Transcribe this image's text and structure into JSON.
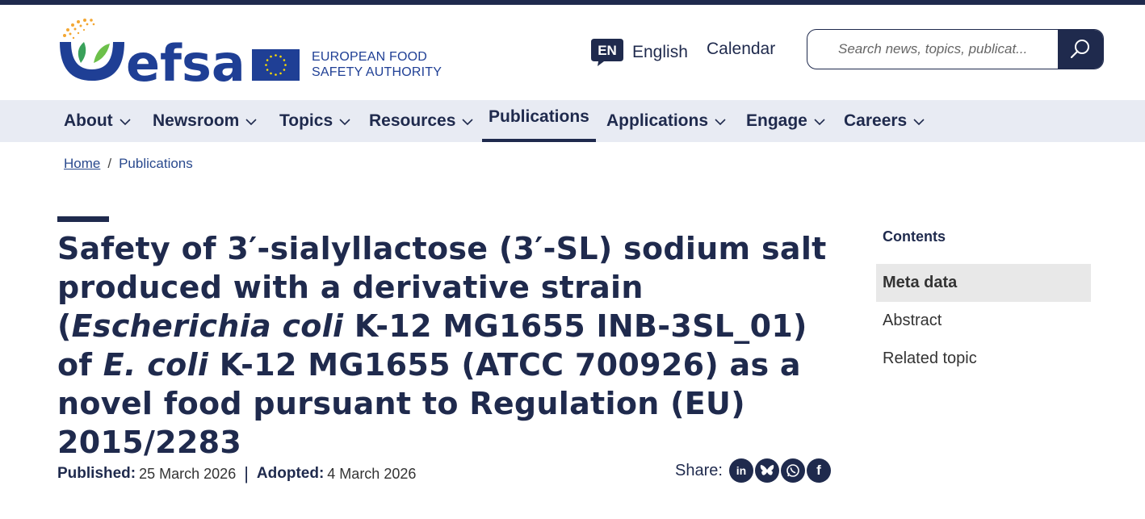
{
  "header": {
    "logo_text": "efsa",
    "authority_line1": "EUROPEAN FOOD",
    "authority_line2": "SAFETY AUTHORITY",
    "lang_badge": "EN",
    "lang_label": "English",
    "calendar_label": "Calendar",
    "search_placeholder": "Search news, topics, publicat..."
  },
  "nav": {
    "items": [
      {
        "label": "About"
      },
      {
        "label": "Newsroom"
      },
      {
        "label": "Topics"
      },
      {
        "label": "Resources"
      },
      {
        "label": "Publications"
      },
      {
        "label": "Applications"
      },
      {
        "label": "Engage"
      },
      {
        "label": "Careers"
      }
    ]
  },
  "breadcrumb": {
    "home": "Home",
    "separator": "/",
    "current": "Publications"
  },
  "article": {
    "title_part1": "Safety of 3′-sialyllactose (3′-SL) sodium salt produced with a derivative strain (",
    "title_italic1": "Escherichia coli",
    "title_part2": " K-12 MG1655 INB-3SL_01) of ",
    "title_italic2": "E. coli",
    "title_part3": " K-12 MG1655 (ATCC 700926) as a novel food pursuant to Regulation (EU) 2015/2283",
    "published_label": "Published:",
    "published_value": "25 March 2026",
    "pipe": "|",
    "adopted_label": "Adopted:",
    "adopted_value": "4 March 2026",
    "share_label": "Share:",
    "share_icons": [
      "linkedin-icon",
      "bluesky-icon",
      "whatsapp-icon",
      "facebook-icon"
    ],
    "share_texts": {
      "linkedin": "in",
      "facebook": "f"
    }
  },
  "contents": {
    "heading": "Contents",
    "items": [
      {
        "label": "Meta data"
      },
      {
        "label": "Abstract"
      },
      {
        "label": "Related topic"
      }
    ]
  },
  "colors": {
    "navy": "#1f2a4d",
    "eu_blue": "#1f3f95",
    "nav_bg": "#e8ebf3",
    "logo_green": "#3aa15a",
    "logo_gold": "#f3a733"
  }
}
